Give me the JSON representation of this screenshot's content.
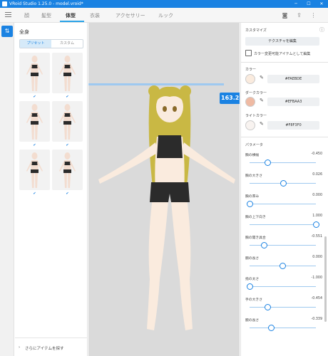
{
  "window": {
    "title": "VRoid Studio 1.25.0 - model.vroid*",
    "minimize": "─",
    "maximize": "☐",
    "close": "✕"
  },
  "tabs": [
    {
      "label": "顔"
    },
    {
      "label": "髪型"
    },
    {
      "label": "体型"
    },
    {
      "label": "衣装"
    },
    {
      "label": "アクセサリー"
    },
    {
      "label": "ルック"
    }
  ],
  "rail": {
    "icon_glyph": "⇅"
  },
  "left_panel": {
    "title": "全身",
    "segments": {
      "preset": "プリセット",
      "custom": "カスタム"
    },
    "more_items": "さらにアイテムを探す",
    "check_glyph": "✔",
    "chevron_glyph": "›"
  },
  "viewport": {
    "height_label": "163.2"
  },
  "right_panel": {
    "customize_title": "カスタマイズ",
    "edit_texture": "テクスチャを編集",
    "color_changeable": "カラー変更可能アイテムとして編集",
    "colors": [
      {
        "label": "カラー",
        "hex": "#FAEBDE"
      },
      {
        "label": "ダークカラー",
        "hex": "#EFBAA3"
      },
      {
        "label": "ライトカラー",
        "hex": "#F8F3F0"
      }
    ],
    "params_title": "パラメータ",
    "params": [
      {
        "label": "胸の横幅",
        "value": "-0.450",
        "fraction": 0.275
      },
      {
        "label": "胸の大きさ",
        "value": "0.026",
        "fraction": 0.513
      },
      {
        "label": "胸の厚み",
        "value": "0.000",
        "fraction": 0.0
      },
      {
        "label": "胸の上下向き",
        "value": "1.000",
        "fraction": 1.0
      },
      {
        "label": "胸の開き具合",
        "value": "-0.551",
        "fraction": 0.225
      },
      {
        "label": "胴の長さ",
        "value": "0.000",
        "fraction": 0.5
      },
      {
        "label": "指の太さ",
        "value": "-1.000",
        "fraction": 0.0
      },
      {
        "label": "手の大きさ",
        "value": "-0.454",
        "fraction": 0.273
      },
      {
        "label": "腕の長さ",
        "value": "-0.339",
        "fraction": 0.33
      }
    ]
  },
  "colors": {
    "accent": "#1a82e2",
    "skin": "#faebde",
    "hair": "#c9b844",
    "outfit": "#2b2b2b"
  }
}
